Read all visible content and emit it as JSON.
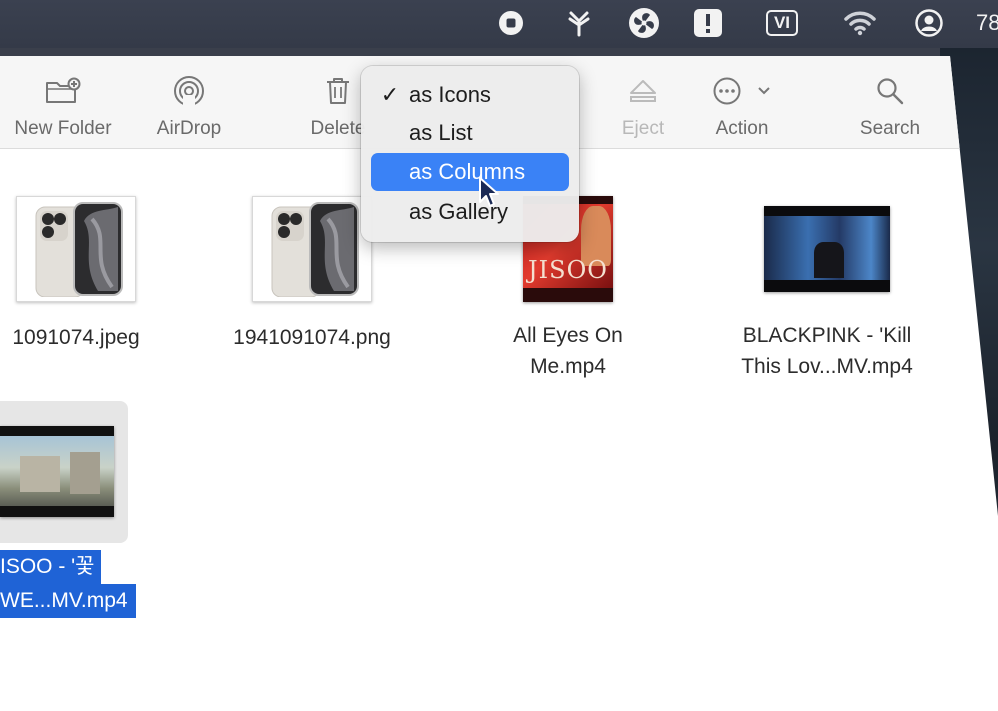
{
  "menubar": {
    "icons": [
      "stop-circle-icon",
      "fork-icon",
      "fan-icon",
      "warning-icon",
      "vi-input-icon",
      "wifi-icon",
      "user-circle-icon"
    ],
    "input_method": "VI",
    "clock_fragment": "78"
  },
  "toolbar": {
    "new_folder": "New Folder",
    "airdrop": "AirDrop",
    "delete": "Delete",
    "eject": "Eject",
    "action": "Action",
    "search": "Search"
  },
  "view_menu": {
    "items": [
      {
        "label": "as Icons",
        "checked": true
      },
      {
        "label": "as List",
        "checked": false
      },
      {
        "label": "as Columns",
        "checked": false,
        "highlighted": true
      },
      {
        "label": "as Gallery",
        "checked": false
      }
    ],
    "check_glyph": "✓"
  },
  "files": [
    {
      "name": "1091074.jpeg",
      "type": "image"
    },
    {
      "name": "1941091074.png",
      "type": "image"
    },
    {
      "name_line1": "All Eyes On",
      "name_line2": "Me.mp4",
      "type": "video",
      "thumb_text": "JISOO"
    },
    {
      "name_line1": "BLACKPINK - 'Kill",
      "name_line2": "This Lov...MV.mp4",
      "type": "video"
    },
    {
      "name_line1": "ISOO - '꽃",
      "name_line2": "WE...MV.mp4",
      "type": "video",
      "selected": true
    }
  ],
  "colors": {
    "selection": "#1f63d6",
    "menu_highlight": "#3a82f6"
  }
}
